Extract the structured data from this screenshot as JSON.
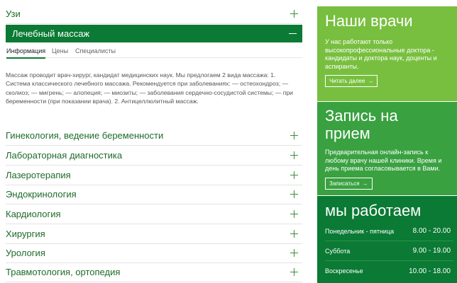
{
  "accordion": {
    "top_item": {
      "label": "Узи"
    },
    "active_item": {
      "label": "Лечебный массаж",
      "tabs": [
        "Информация",
        "Цены",
        "Специалисты"
      ],
      "description": "Массаж проводит врач-хирург, кандидат медицинских наук. Мы предлогаем 2 вида массажа: 1. Система классического лечебного массажа. Рекомендуется при заболеваниях: — остеохондроз; — сколиоз; — мигрень; — алопеция; — миозиты; — заболевания сердечно-сосудистой системы; — при беременности (при показании врача). 2. Антицеллюлитный массаж."
    },
    "items": [
      {
        "label": "Гинекология, ведение беременности"
      },
      {
        "label": "Лабораторная диагностика"
      },
      {
        "label": "Лазеротерапия"
      },
      {
        "label": "Эндокринология"
      },
      {
        "label": "Кардиология"
      },
      {
        "label": "Хирургия"
      },
      {
        "label": "Урология"
      },
      {
        "label": "Травмотология, ортопедия"
      }
    ]
  },
  "doctors_panel": {
    "title": "Наши врачи",
    "text": "У нас работают только высокопрофессиональные доктора - кандидаты и доктора наук, доценты и аспиранты.",
    "button": "Читать далее"
  },
  "appointment_panel": {
    "title": "Запись на прием",
    "text": "Предварительная онлайн-запись к любому врачу нашей клиники. Время и день приема согласовывается в Вами.",
    "button": "Записаться"
  },
  "schedule_panel": {
    "title": "мы работаем",
    "rows": [
      {
        "day": "Понедельник - пятница",
        "time": "8.00 - 20.00"
      },
      {
        "day": "Суббота",
        "time": "9.00 - 19.00"
      },
      {
        "day": "Воскресенье",
        "time": "10.00 - 18.00"
      }
    ]
  },
  "colors": {
    "dark_green": "#0a7a34",
    "light_green": "#78bf3f",
    "mid_green": "#3aa141",
    "link_green": "#1e6b2a"
  },
  "icons": {
    "expand": "plus-icon",
    "collapse": "minus-icon",
    "button_arrow": "arrow-right-icon"
  }
}
